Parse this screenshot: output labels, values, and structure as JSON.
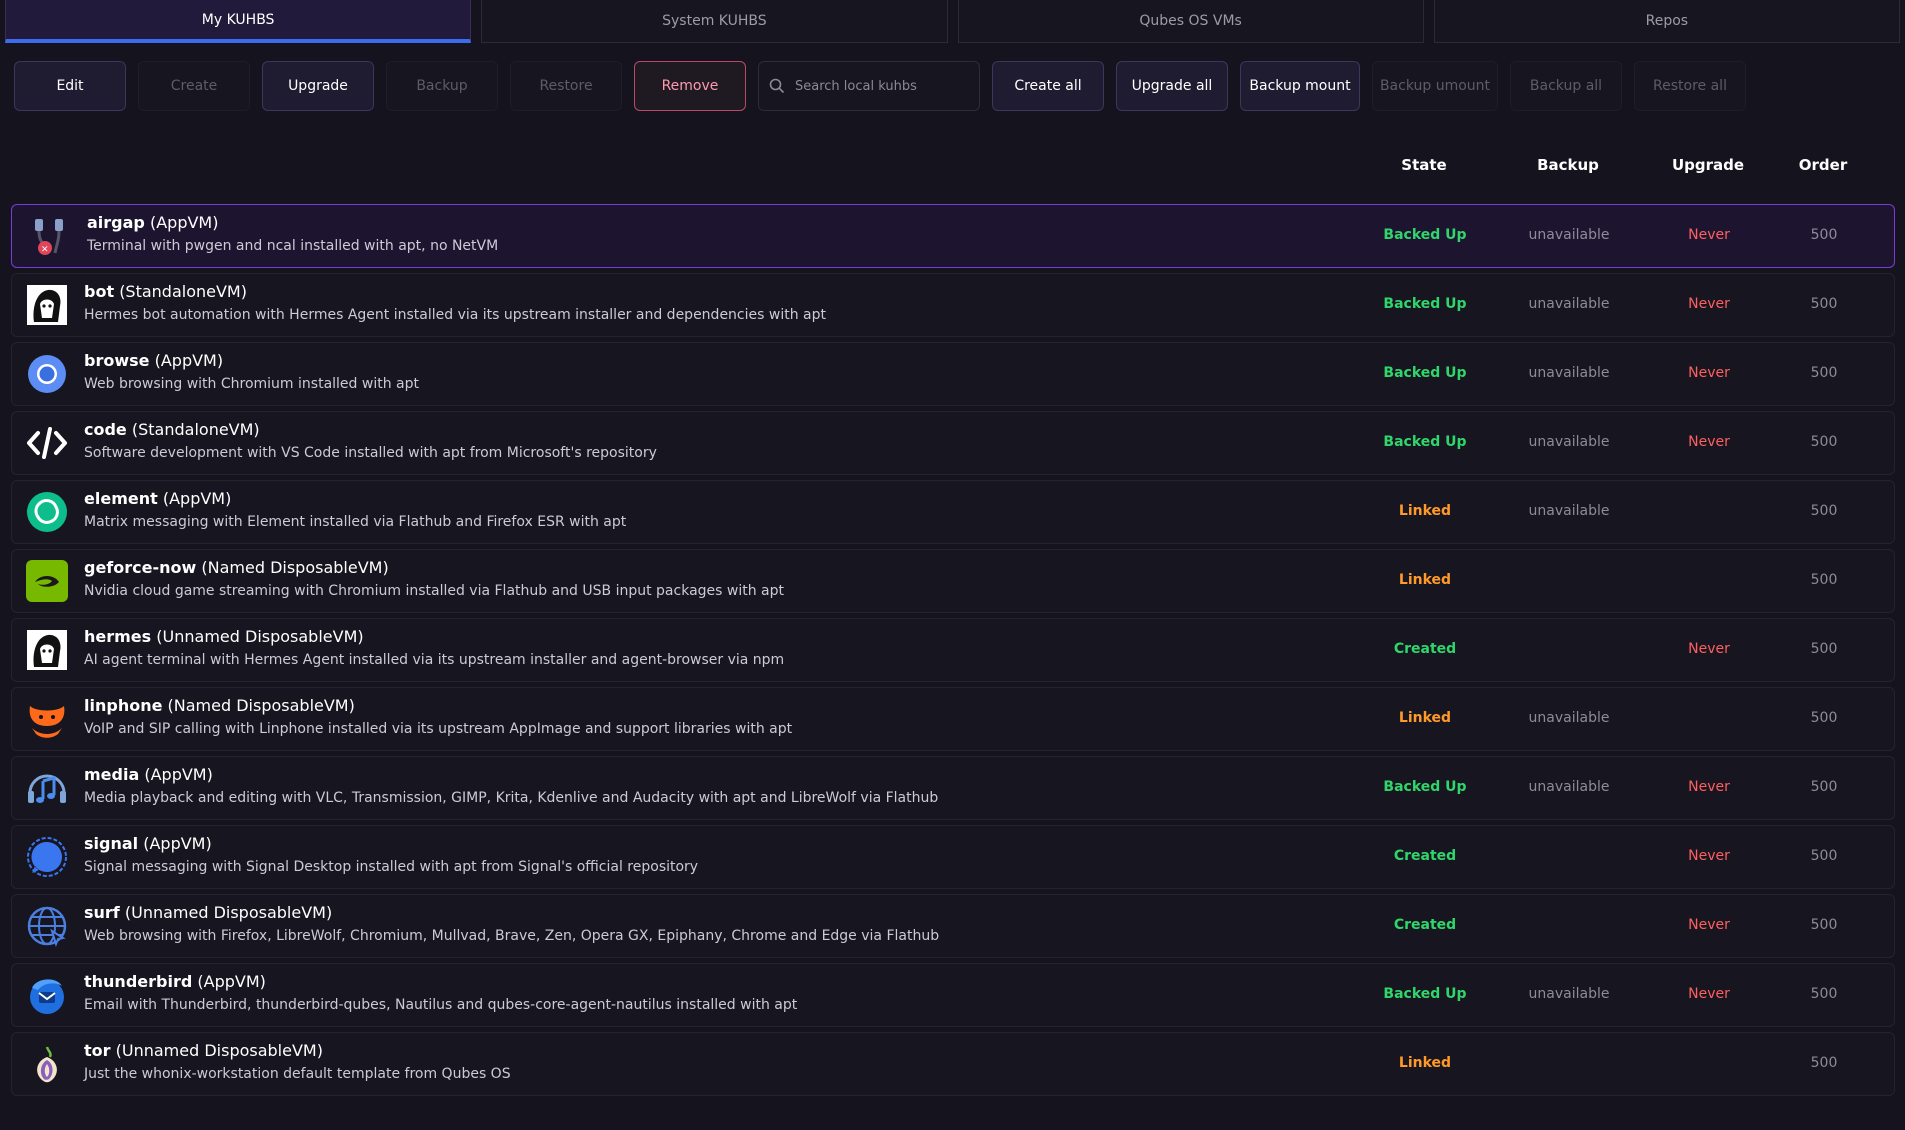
{
  "tabs": [
    {
      "label": "My KUHBS",
      "active": true
    },
    {
      "label": "System KUHBS",
      "active": false
    },
    {
      "label": "Qubes OS VMs",
      "active": false
    },
    {
      "label": "Repos",
      "active": false
    }
  ],
  "toolbar": {
    "edit": "Edit",
    "create": "Create",
    "upgrade": "Upgrade",
    "backup": "Backup",
    "restore": "Restore",
    "remove": "Remove",
    "search_placeholder": "Search local kuhbs",
    "create_all": "Create all",
    "upgrade_all": "Upgrade all",
    "backup_mount": "Backup mount",
    "backup_umount": "Backup umount",
    "backup_all": "Backup all",
    "restore_all": "Restore all"
  },
  "columns": {
    "state": "State",
    "backup": "Backup",
    "upgrade": "Upgrade",
    "order": "Order"
  },
  "rows": [
    {
      "name": "airgap",
      "type": "(AppVM)",
      "description": "Terminal with pwgen and ncal installed with apt, no NetVM",
      "state": "Backed Up",
      "backup": "unavailable",
      "upgrade": "Never",
      "order": "500",
      "icon": "airgap-icon"
    },
    {
      "name": "bot",
      "type": "(StandaloneVM)",
      "description": "Hermes bot automation with Hermes Agent installed via its upstream installer and dependencies with apt",
      "state": "Backed Up",
      "backup": "unavailable",
      "upgrade": "Never",
      "order": "500",
      "icon": "hermes-icon"
    },
    {
      "name": "browse",
      "type": "(AppVM)",
      "description": "Web browsing with Chromium installed with apt",
      "state": "Backed Up",
      "backup": "unavailable",
      "upgrade": "Never",
      "order": "500",
      "icon": "chromium-icon"
    },
    {
      "name": "code",
      "type": "(StandaloneVM)",
      "description": "Software development with VS Code installed with apt from Microsoft's repository",
      "state": "Backed Up",
      "backup": "unavailable",
      "upgrade": "Never",
      "order": "500",
      "icon": "code-icon"
    },
    {
      "name": "element",
      "type": "(AppVM)",
      "description": "Matrix messaging with Element installed via Flathub and Firefox ESR with apt",
      "state": "Linked",
      "backup": "unavailable",
      "upgrade": "",
      "order": "500",
      "icon": "element-icon"
    },
    {
      "name": "geforce-now",
      "type": "(Named DisposableVM)",
      "description": "Nvidia cloud game streaming with Chromium installed via Flathub and USB input packages with apt",
      "state": "Linked",
      "backup": "",
      "upgrade": "",
      "order": "500",
      "icon": "nvidia-icon"
    },
    {
      "name": "hermes",
      "type": "(Unnamed DisposableVM)",
      "description": "AI agent terminal with Hermes Agent installed via its upstream installer and agent-browser via npm",
      "state": "Created",
      "backup": "",
      "upgrade": "Never",
      "order": "500",
      "icon": "hermes-icon"
    },
    {
      "name": "linphone",
      "type": "(Named DisposableVM)",
      "description": "VoIP and SIP calling with Linphone installed via its upstream AppImage and support libraries with apt",
      "state": "Linked",
      "backup": "unavailable",
      "upgrade": "",
      "order": "500",
      "icon": "linphone-icon"
    },
    {
      "name": "media",
      "type": "(AppVM)",
      "description": "Media playback and editing with VLC, Transmission, GIMP, Krita, Kdenlive and Audacity with apt and LibreWolf via Flathub",
      "state": "Backed Up",
      "backup": "unavailable",
      "upgrade": "Never",
      "order": "500",
      "icon": "music-icon"
    },
    {
      "name": "signal",
      "type": "(AppVM)",
      "description": "Signal messaging with Signal Desktop installed with apt from Signal's official repository",
      "state": "Created",
      "backup": "",
      "upgrade": "Never",
      "order": "500",
      "icon": "signal-icon"
    },
    {
      "name": "surf",
      "type": "(Unnamed DisposableVM)",
      "description": "Web browsing with Firefox, LibreWolf, Chromium, Mullvad, Brave, Zen, Opera GX, Epiphany, Chrome and Edge via Flathub",
      "state": "Created",
      "backup": "",
      "upgrade": "Never",
      "order": "500",
      "icon": "globe-icon"
    },
    {
      "name": "thunderbird",
      "type": "(AppVM)",
      "description": "Email with Thunderbird, thunderbird-qubes, Nautilus and qubes-core-agent-nautilus installed with apt",
      "state": "Backed Up",
      "backup": "unavailable",
      "upgrade": "Never",
      "order": "500",
      "icon": "thunderbird-icon"
    },
    {
      "name": "tor",
      "type": "(Unnamed DisposableVM)",
      "description": "Just the whonix-workstation default template from Qubes OS",
      "state": "Linked",
      "backup": "",
      "upgrade": "",
      "order": "500",
      "icon": "tor-onion-icon"
    }
  ],
  "colors": {
    "accent": "#3b6cf0",
    "selected_border": "#7a3cd9",
    "backed_up": "#2fd66b",
    "linked": "#ff9a2a",
    "never": "#ff5f5f"
  }
}
